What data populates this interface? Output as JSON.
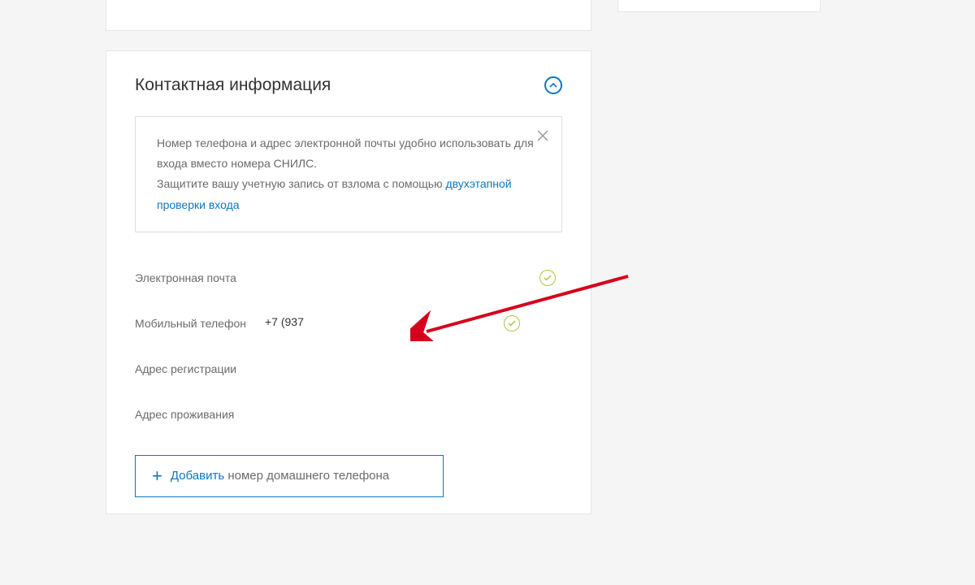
{
  "card": {
    "title": "Контактная информация",
    "infoBox": {
      "line1": "Номер телефона и адрес электронной почты удобно использовать для входа вместо номера СНИЛС.",
      "line2_prefix": "Защитите вашу учетную запись от взлома с помощью ",
      "link": "двухэтапной проверки входа"
    },
    "fields": {
      "email": {
        "label": "Электронная почта",
        "value": ""
      },
      "mobile": {
        "label": "Мобильный телефон",
        "value": "+7 (937"
      },
      "regAddress": {
        "label": "Адрес регистрации",
        "value": ""
      },
      "liveAddress": {
        "label": "Адрес проживания",
        "value": ""
      }
    },
    "addButton": {
      "lead": "Добавить",
      "rest": " номер домашнего телефона"
    }
  }
}
